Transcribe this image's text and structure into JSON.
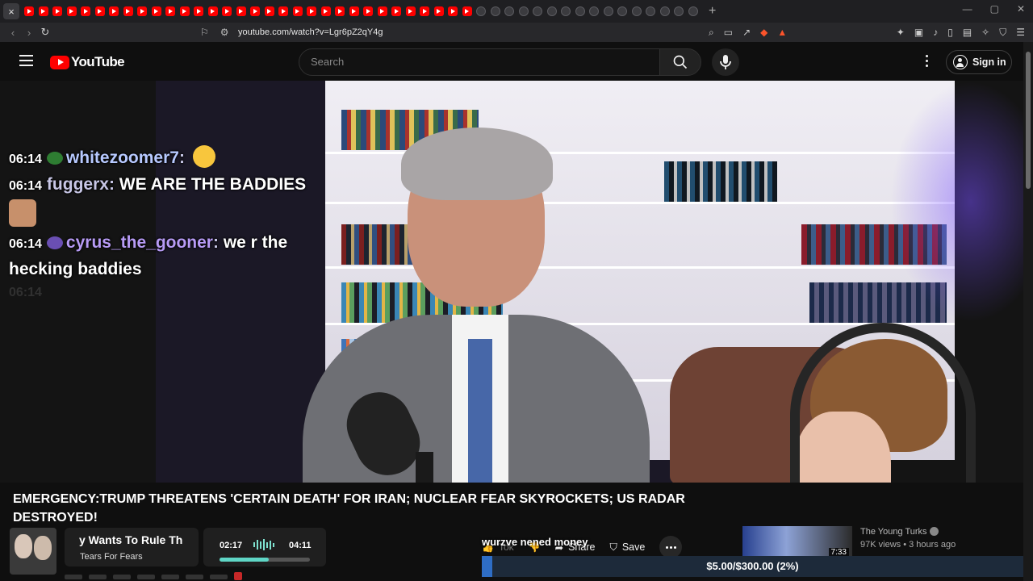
{
  "browser": {
    "url": "youtube.com/watch?v=Lgr6pZ2qY4g",
    "tab_close_glyph": "×",
    "new_tab_glyph": "+"
  },
  "header": {
    "logo_text": "YouTube",
    "search_placeholder": "Search",
    "sign_in_label": "Sign in"
  },
  "chat": {
    "messages": [
      {
        "time": "06:14",
        "user": "whitezoomer7",
        "separator": ":",
        "text": ""
      },
      {
        "time": "06:14",
        "user": "fuggerx",
        "separator": ":",
        "text": "WE ARE THE BADDIES"
      },
      {
        "time": "06:14",
        "user": "cyrus_the_gooner",
        "separator": ":",
        "text": "we r the",
        "continuation": "hecking baddies"
      }
    ],
    "faded_time": "06:14"
  },
  "video": {
    "title": "EMERGENCY:TRUMP THREATENS 'CERTAIN DEATH' FOR IRAN; NUCLEAR FEAR SKYROCKETS; US RADAR DESTROYED!",
    "caption_overlay": "wurzve nened money"
  },
  "music_widget": {
    "song_title": "y Wants To Rule Th",
    "artist": "Tears For Fears",
    "current_time": "02:17",
    "total_time": "04:11",
    "progress_fraction": 0.545
  },
  "actions": {
    "like_label": "Tok",
    "share_label": "Share",
    "save_label": "Save"
  },
  "recommendation": {
    "duration": "7:33",
    "channel": "The Young Turks",
    "meta": "97K views • 3 hours ago"
  },
  "donation": {
    "text": "$5.00/$300.00 (2%)",
    "fraction": 0.02
  },
  "colors": {
    "accent_red": "#ff0000",
    "donation_fill": "#2e6dc5",
    "progress_fill": "#5fd6c6"
  }
}
